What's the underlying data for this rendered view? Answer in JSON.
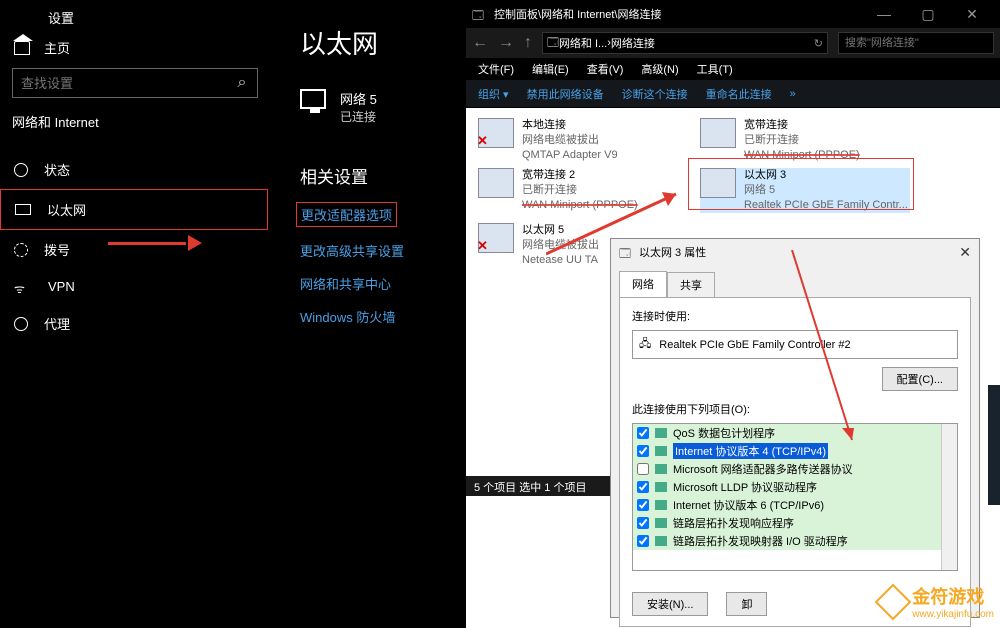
{
  "settings": {
    "window_title": "设置",
    "home": "主页",
    "search_placeholder": "查找设置",
    "section": "网络和 Internet",
    "nav": [
      "状态",
      "以太网",
      "拨号",
      "VPN",
      "代理"
    ],
    "main_heading": "以太网",
    "network": {
      "name": "网络 5",
      "state": "已连接"
    },
    "related_heading": "相关设置",
    "links": [
      "更改适配器选项",
      "更改高级共享设置",
      "网络和共享中心",
      "Windows 防火墙"
    ]
  },
  "statusbar": "5 个项目    选中 1 个项目",
  "cp": {
    "title": "控制面板\\网络和 Internet\\网络连接",
    "breadcrumb": [
      "网络和 I...",
      "网络连接"
    ],
    "search_placeholder": "搜索\"网络连接\"",
    "menu": [
      "文件(F)",
      "编辑(E)",
      "查看(V)",
      "高级(N)",
      "工具(T)"
    ],
    "toolbar": [
      "组织 ▾",
      "禁用此网络设备",
      "诊断这个连接",
      "重命名此连接",
      "»"
    ],
    "adapters": [
      {
        "l1": "本地连接",
        "l2": "网络电缆被拔出",
        "l3": "QMTAP Adapter V9",
        "x": true
      },
      {
        "l1": "宽带连接",
        "l2": "已断开连接",
        "l3": "WAN Miniport (PPPOE)",
        "strike": true
      },
      {
        "l1": "宽带连接 2",
        "l2": "已断开连接",
        "l3": "WAN Miniport (PPPOE)",
        "strike": true
      },
      {
        "l1": "以太网 3",
        "l2": "网络 5",
        "l3": "Realtek PCIe GbE Family Contr...",
        "sel": true
      },
      {
        "l1": "以太网 5",
        "l2": "网络电缆被拔出",
        "l3": "Netease UU TA",
        "x": true
      }
    ]
  },
  "dlg": {
    "title": "以太网 3 属性",
    "tabs": [
      "网络",
      "共享"
    ],
    "connect_label": "连接时使用:",
    "device": "Realtek PCIe GbE Family Controller #2",
    "configure_btn": "配置(C)...",
    "items_label": "此连接使用下列项目(O):",
    "items": [
      {
        "c": true,
        "t": "QoS 数据包计划程序"
      },
      {
        "c": true,
        "t": "Internet 协议版本 4 (TCP/IPv4)",
        "sel": true
      },
      {
        "c": false,
        "t": "Microsoft 网络适配器多路传送器协议"
      },
      {
        "c": true,
        "t": "Microsoft LLDP 协议驱动程序"
      },
      {
        "c": true,
        "t": "Internet 协议版本 6 (TCP/IPv6)"
      },
      {
        "c": true,
        "t": "链路层拓扑发现响应程序"
      },
      {
        "c": true,
        "t": "链路层拓扑发现映射器 I/O 驱动程序"
      }
    ],
    "install_btn": "安装(N)...",
    "uninstall_btn": "卸"
  },
  "watermark": {
    "name": "金符游戏",
    "url": "www.yikajinfu.com"
  }
}
